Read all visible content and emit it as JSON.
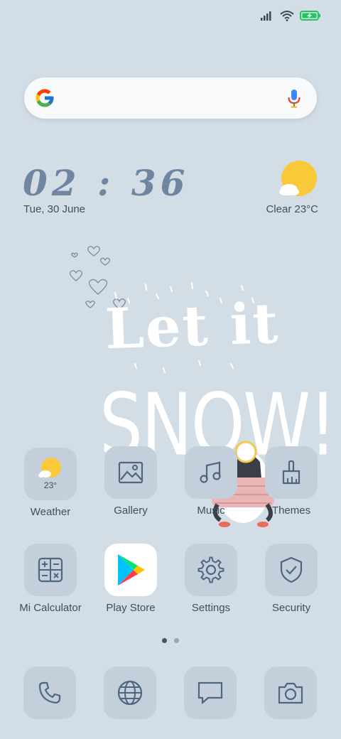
{
  "status_bar": {
    "signal_icon": "signal-icon",
    "wifi_icon": "wifi-icon",
    "battery_icon": "battery-charging-icon",
    "battery_color": "#22c55e"
  },
  "search": {
    "google_icon": "google-icon",
    "mic_icon": "microphone-icon"
  },
  "clock_widget": {
    "time": "02 : 36",
    "date": "Tue, 30 June"
  },
  "weather_widget": {
    "icon": "sun-cloud-icon",
    "condition_temp": "Clear  23°C"
  },
  "wallpaper": {
    "line1": "Let it",
    "line2": "SNOW!"
  },
  "apps_row1": [
    {
      "label": "Weather",
      "icon": "sun-cloud-icon",
      "value": "23°"
    },
    {
      "label": "Gallery",
      "icon": "image-icon"
    },
    {
      "label": "Music",
      "icon": "music-note-icon"
    },
    {
      "label": "Themes",
      "icon": "paintbrush-icon"
    }
  ],
  "apps_row2": [
    {
      "label": "Mi Calculator",
      "icon": "calculator-icon"
    },
    {
      "label": "Play Store",
      "icon": "play-store-icon"
    },
    {
      "label": "Settings",
      "icon": "gear-icon"
    },
    {
      "label": "Security",
      "icon": "shield-check-icon"
    }
  ],
  "page_indicator": {
    "pages": 2,
    "current": 1
  },
  "dock": [
    {
      "icon": "phone-icon"
    },
    {
      "icon": "globe-icon"
    },
    {
      "icon": "message-icon"
    },
    {
      "icon": "camera-icon"
    }
  ]
}
